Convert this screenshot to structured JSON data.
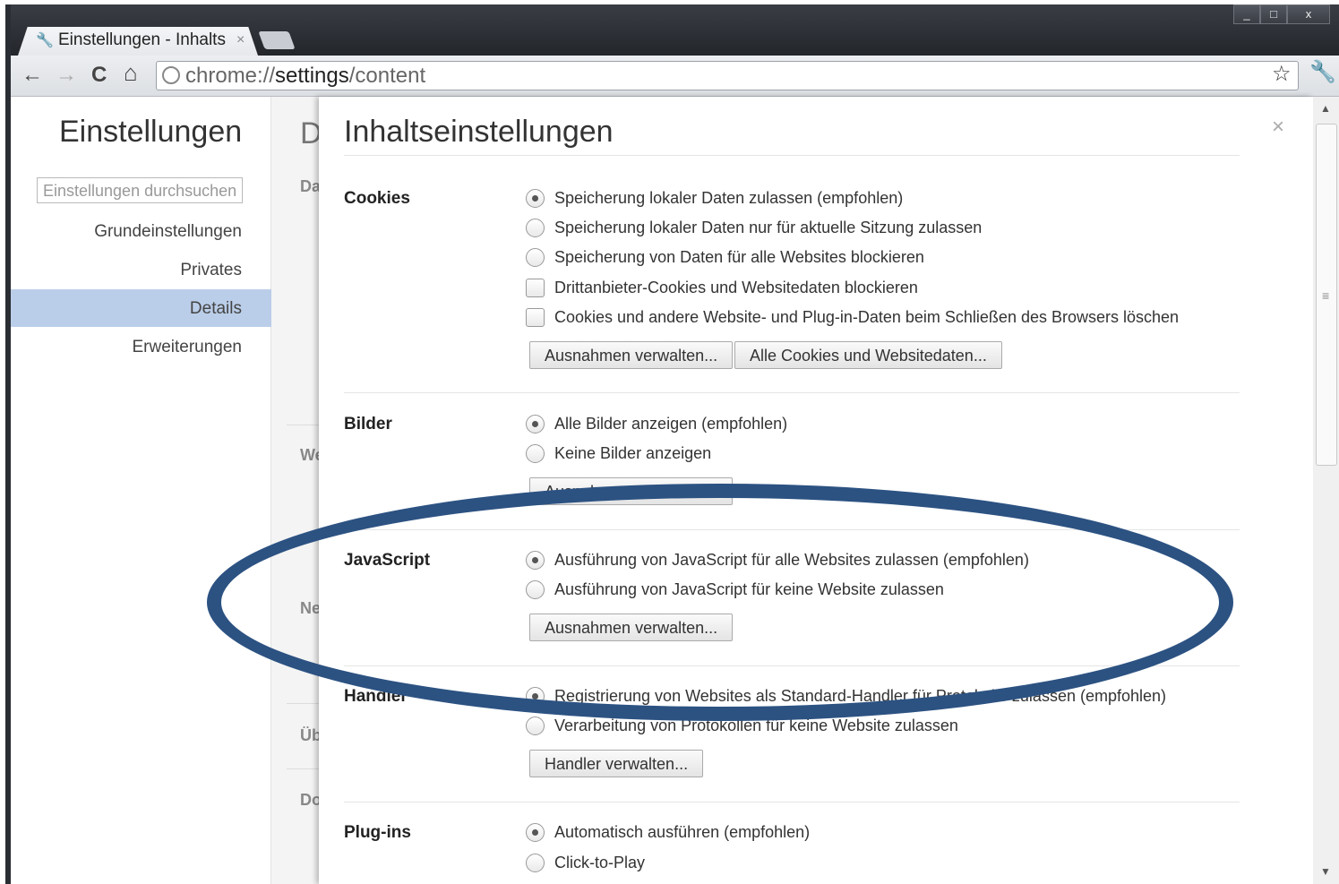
{
  "window": {
    "tab_title": "Einstellungen - Inhalts",
    "tab_close": "×",
    "minimize": "_",
    "maximize": "□",
    "close": "x"
  },
  "toolbar": {
    "back": "←",
    "forward": "→",
    "reload": "C",
    "home": "⌂",
    "url_scheme": "chrome://",
    "url_host": "settings",
    "url_path": "/content",
    "bookmark_star": "☆",
    "wrench": "🔧"
  },
  "sidebar": {
    "title": "Einstellungen",
    "search_placeholder": "Einstellungen durchsuchen",
    "items": [
      {
        "label": "Grundeinstellungen"
      },
      {
        "label": "Privates"
      },
      {
        "label": "Details"
      },
      {
        "label": "Erweiterungen"
      }
    ]
  },
  "background_fragments": [
    "D",
    "Da",
    "We",
    "Ne",
    "Üb",
    "Do"
  ],
  "dialog": {
    "title": "Inhaltseinstellungen",
    "close": "×",
    "cookies": {
      "label": "Cookies",
      "options": [
        {
          "text": "Speicherung lokaler Daten zulassen (empfohlen)",
          "checked": true
        },
        {
          "text": "Speicherung lokaler Daten nur für aktuelle Sitzung zulassen",
          "checked": false
        },
        {
          "text": "Speicherung von Daten für alle Websites blockieren",
          "checked": false
        }
      ],
      "checkboxes": [
        {
          "text": "Drittanbieter-Cookies und Websitedaten blockieren",
          "checked": false
        },
        {
          "text": "Cookies und andere Website- und Plug-in-Daten beim Schließen des Browsers löschen",
          "checked": false
        }
      ],
      "btn_exceptions": "Ausnahmen verwalten...",
      "btn_all": "Alle Cookies und Websitedaten..."
    },
    "images": {
      "label": "Bilder",
      "options": [
        {
          "text": "Alle Bilder anzeigen (empfohlen)",
          "checked": true
        },
        {
          "text": "Keine Bilder anzeigen",
          "checked": false
        }
      ],
      "btn_exceptions": "Ausnahmen verwalten..."
    },
    "javascript": {
      "label": "JavaScript",
      "options": [
        {
          "text": "Ausführung von JavaScript für alle Websites zulassen (empfohlen)",
          "checked": true
        },
        {
          "text": "Ausführung von JavaScript für keine Website zulassen",
          "checked": false
        }
      ],
      "btn_exceptions": "Ausnahmen verwalten..."
    },
    "handlers": {
      "label": "Handler",
      "options": [
        {
          "text": "Registrierung von Websites als Standard-Handler für Protokolle zulassen (empfohlen)",
          "checked": true
        },
        {
          "text": "Verarbeitung von Protokollen für keine Website zulassen",
          "checked": false
        }
      ],
      "btn_manage": "Handler verwalten..."
    },
    "plugins": {
      "label": "Plug-ins",
      "options": [
        {
          "text": "Automatisch ausführen (empfohlen)",
          "checked": true
        },
        {
          "text": "Click-to-Play",
          "checked": false
        }
      ]
    }
  },
  "annotation": {
    "color": "#2c5282"
  }
}
